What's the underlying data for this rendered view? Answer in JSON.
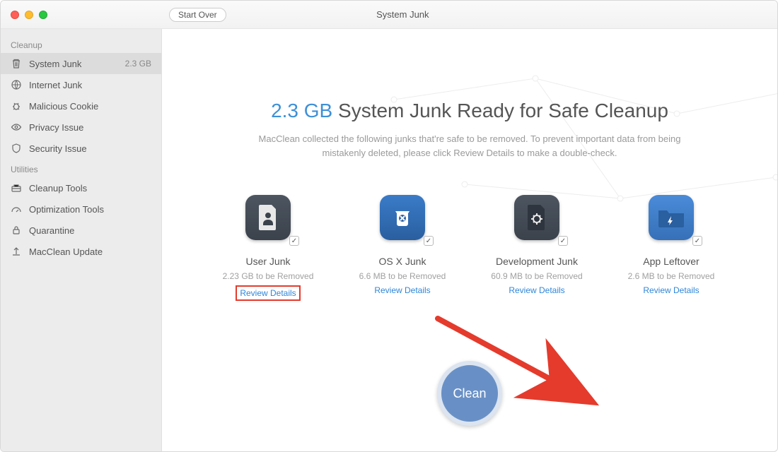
{
  "window": {
    "title": "System Junk",
    "start_over": "Start Over"
  },
  "sidebar": {
    "sections": [
      {
        "label": "Cleanup",
        "items": [
          {
            "id": "system-junk",
            "label": "System Junk",
            "badge": "2.3 GB",
            "active": true
          },
          {
            "id": "internet-junk",
            "label": "Internet Junk"
          },
          {
            "id": "malicious-cookie",
            "label": "Malicious Cookie"
          },
          {
            "id": "privacy-issue",
            "label": "Privacy Issue"
          },
          {
            "id": "security-issue",
            "label": "Security Issue"
          }
        ]
      },
      {
        "label": "Utilities",
        "items": [
          {
            "id": "cleanup-tools",
            "label": "Cleanup Tools"
          },
          {
            "id": "optimization-tools",
            "label": "Optimization Tools"
          },
          {
            "id": "quarantine",
            "label": "Quarantine"
          },
          {
            "id": "macclean-update",
            "label": "MacClean Update"
          }
        ]
      }
    ]
  },
  "main": {
    "headline_accent": "2.3 GB",
    "headline_rest": " System Junk Ready for Safe Cleanup",
    "subtext": "MacClean collected the following junks that're safe to be removed. To prevent important data from being mistakenly deleted, please click Review Details to make a double-check.",
    "clean_label": "Clean",
    "categories": [
      {
        "title": "User Junk",
        "sub": "2.23 GB to be Removed",
        "link": "Review Details",
        "highlight": true
      },
      {
        "title": "OS X Junk",
        "sub": "6.6 MB to be Removed",
        "link": "Review Details"
      },
      {
        "title": "Development Junk",
        "sub": "60.9 MB to be Removed",
        "link": "Review Details"
      },
      {
        "title": "App Leftover",
        "sub": "2.6 MB to be Removed",
        "link": "Review Details"
      }
    ]
  },
  "colors": {
    "accent": "#3d90d8",
    "annotation": "#e43b2d"
  }
}
